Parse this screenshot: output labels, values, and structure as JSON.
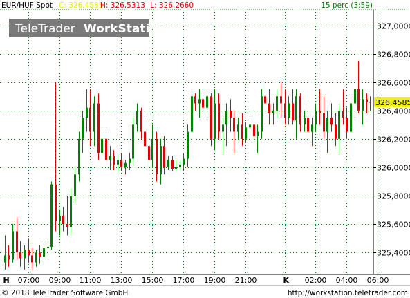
{
  "header": {
    "symbol": "EUR/HUF Spot",
    "close_label": "C: 326,4585",
    "high_label": "H: 326,5313",
    "low_label": "L: 326,2660",
    "interval": "15 perc (3:59)"
  },
  "watermark": {
    "part1": "TeleTrader",
    "part2": "WorkStation"
  },
  "last_price_label": "326,4585",
  "footer": {
    "copyright": "© 2018 TeleTrader Software GmbH",
    "url": "http://workstation.teletrader.com"
  },
  "colors": {
    "up": "#008000",
    "down": "#e00000",
    "grid": "#008000",
    "close_text": "#e8e800",
    "hl_text": "#e00000",
    "interval_text": "#008000",
    "price_marker": "#f0f000"
  },
  "chart_data": {
    "type": "candlestick",
    "ylim": [
      325.25,
      327.1
    ],
    "y_ticks": [
      325.4,
      325.6,
      325.8,
      326.0,
      326.2,
      326.4,
      326.6,
      326.8,
      327.0
    ],
    "y_tick_labels": [
      "325,4000",
      "325,6000",
      "325,8000",
      "326,0000",
      "326,2000",
      "326,4000",
      "326,6000",
      "326,8000",
      "327,0000"
    ],
    "x_tick_labels": [
      "H",
      "07:00",
      "09:00",
      "11:00",
      "13:00",
      "15:00",
      "17:00",
      "19:00",
      "21:00",
      "K",
      "02:00",
      "04:00",
      "06:00"
    ],
    "x_tick_index": [
      0,
      6,
      14,
      22,
      30,
      38,
      46,
      54,
      62,
      72,
      80,
      88,
      96
    ],
    "grid": true,
    "last": 326.4585,
    "candles": [
      [
        325.33,
        325.52,
        325.28,
        325.38
      ],
      [
        325.38,
        325.45,
        325.3,
        325.35
      ],
      [
        325.35,
        325.6,
        325.33,
        325.55
      ],
      [
        325.55,
        325.65,
        325.35,
        325.4
      ],
      [
        325.4,
        325.48,
        325.3,
        325.36
      ],
      [
        325.36,
        325.45,
        325.28,
        325.42
      ],
      [
        325.42,
        325.5,
        325.33,
        325.38
      ],
      [
        325.38,
        325.44,
        325.28,
        325.33
      ],
      [
        325.33,
        325.42,
        325.3,
        325.4
      ],
      [
        325.4,
        325.45,
        325.32,
        325.37
      ],
      [
        325.37,
        325.47,
        325.33,
        325.43
      ],
      [
        325.43,
        325.48,
        325.38,
        325.44
      ],
      [
        325.44,
        325.9,
        325.42,
        325.88
      ],
      [
        325.88,
        326.6,
        325.55,
        325.62
      ],
      [
        325.62,
        325.7,
        325.52,
        325.66
      ],
      [
        325.66,
        325.72,
        325.55,
        325.6
      ],
      [
        325.6,
        325.8,
        325.52,
        325.58
      ],
      [
        325.58,
        325.85,
        325.52,
        325.8
      ],
      [
        325.8,
        326.0,
        325.75,
        325.95
      ],
      [
        325.95,
        326.25,
        325.9,
        326.2
      ],
      [
        326.2,
        326.4,
        326.1,
        326.35
      ],
      [
        326.35,
        326.55,
        326.25,
        326.42
      ],
      [
        326.42,
        326.55,
        326.15,
        326.25
      ],
      [
        326.25,
        326.5,
        326.15,
        326.45
      ],
      [
        326.45,
        326.52,
        326.05,
        326.1
      ],
      [
        326.1,
        326.25,
        326.05,
        326.2
      ],
      [
        326.2,
        326.25,
        326.0,
        326.05
      ],
      [
        326.05,
        326.15,
        325.98,
        326.08
      ],
      [
        326.08,
        326.12,
        325.98,
        326.02
      ],
      [
        326.02,
        326.08,
        325.96,
        326.05
      ],
      [
        326.05,
        326.1,
        325.98,
        326.0
      ],
      [
        326.0,
        326.05,
        325.95,
        326.03
      ],
      [
        326.03,
        326.1,
        325.98,
        326.06
      ],
      [
        326.06,
        326.35,
        326.02,
        326.3
      ],
      [
        326.3,
        326.45,
        326.25,
        326.4
      ],
      [
        326.4,
        326.42,
        326.2,
        326.25
      ],
      [
        326.25,
        326.35,
        326.05,
        326.15
      ],
      [
        326.15,
        326.2,
        326.0,
        326.05
      ],
      [
        326.05,
        326.3,
        326.0,
        326.2
      ],
      [
        326.2,
        326.25,
        325.9,
        325.95
      ],
      [
        325.95,
        326.2,
        325.88,
        326.15
      ],
      [
        326.15,
        326.22,
        325.95,
        326.0
      ],
      [
        326.0,
        326.08,
        325.98,
        326.05
      ],
      [
        326.05,
        326.08,
        325.97,
        325.99
      ],
      [
        325.99,
        326.05,
        325.97,
        326.0
      ],
      [
        326.0,
        326.05,
        325.98,
        326.02
      ],
      [
        326.02,
        326.1,
        325.98,
        326.06
      ],
      [
        326.06,
        326.3,
        326.0,
        326.25
      ],
      [
        326.25,
        326.55,
        326.2,
        326.5
      ],
      [
        326.5,
        326.52,
        326.4,
        326.45
      ],
      [
        326.45,
        326.55,
        326.35,
        326.48
      ],
      [
        326.48,
        326.55,
        326.4,
        326.42
      ],
      [
        326.42,
        326.55,
        326.35,
        326.5
      ],
      [
        326.5,
        326.52,
        326.15,
        326.2
      ],
      [
        326.2,
        326.55,
        326.12,
        326.45
      ],
      [
        326.45,
        326.52,
        326.2,
        326.25
      ],
      [
        326.25,
        326.35,
        326.1,
        326.3
      ],
      [
        326.3,
        326.45,
        326.15,
        326.4
      ],
      [
        326.4,
        326.48,
        326.25,
        326.35
      ],
      [
        326.35,
        326.4,
        326.1,
        326.25
      ],
      [
        326.25,
        326.35,
        326.2,
        326.3
      ],
      [
        326.3,
        326.38,
        326.15,
        326.2
      ],
      [
        326.2,
        326.32,
        326.18,
        326.28
      ],
      [
        326.28,
        326.35,
        326.2,
        326.3
      ],
      [
        326.3,
        326.4,
        326.18,
        326.22
      ],
      [
        326.22,
        326.3,
        326.1,
        326.25
      ],
      [
        326.25,
        326.55,
        326.2,
        326.5
      ],
      [
        326.5,
        326.6,
        326.3,
        326.45
      ],
      [
        326.45,
        326.55,
        326.3,
        326.38
      ],
      [
        326.38,
        326.45,
        326.3,
        326.4
      ],
      [
        326.4,
        326.55,
        326.35,
        326.5
      ],
      [
        326.5,
        326.6,
        326.35,
        326.45
      ],
      [
        326.45,
        326.55,
        326.3,
        326.35
      ],
      [
        326.35,
        326.5,
        326.3,
        326.45
      ],
      [
        326.45,
        326.55,
        326.3,
        326.33
      ],
      [
        326.33,
        326.55,
        326.2,
        326.5
      ],
      [
        326.5,
        326.52,
        326.25,
        326.3
      ],
      [
        326.3,
        326.4,
        326.25,
        326.35
      ],
      [
        326.35,
        326.45,
        326.2,
        326.25
      ],
      [
        326.25,
        326.35,
        326.15,
        326.3
      ],
      [
        326.3,
        326.45,
        326.25,
        326.4
      ],
      [
        326.4,
        326.55,
        326.3,
        326.38
      ],
      [
        326.38,
        326.5,
        326.2,
        326.25
      ],
      [
        326.25,
        326.4,
        326.1,
        326.35
      ],
      [
        326.35,
        326.45,
        326.25,
        326.3
      ],
      [
        326.3,
        326.38,
        326.15,
        326.2
      ],
      [
        326.2,
        326.45,
        326.1,
        326.4
      ],
      [
        326.4,
        326.55,
        326.3,
        326.35
      ],
      [
        326.35,
        326.42,
        326.2,
        326.25
      ],
      [
        326.25,
        326.5,
        326.05,
        326.45
      ],
      [
        326.45,
        326.62,
        326.35,
        326.55
      ],
      [
        326.55,
        326.75,
        326.38,
        326.4
      ],
      [
        326.4,
        326.55,
        326.3,
        326.48
      ],
      [
        326.48,
        326.52,
        326.38,
        326.46
      ],
      [
        326.46,
        326.5,
        326.4,
        326.4585
      ]
    ]
  }
}
